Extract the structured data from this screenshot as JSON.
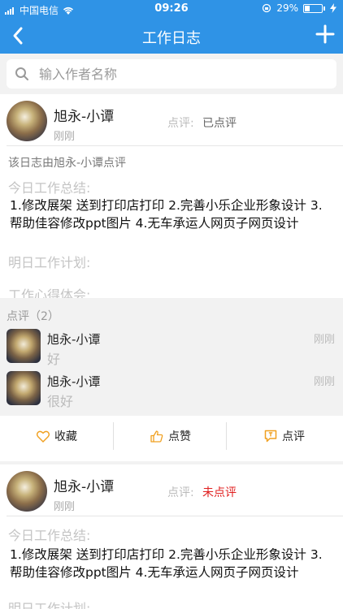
{
  "status_bar": {
    "carrier": "中国电信",
    "time": "09:26",
    "battery": "29%"
  },
  "nav": {
    "title": "工作日志"
  },
  "search": {
    "placeholder": "输入作者名称"
  },
  "colors": {
    "accent": "#2f93e6",
    "unreviewed": "#e02020",
    "comment_icon": "#f0a020"
  },
  "logs": [
    {
      "author": "旭永-小谭",
      "time": "刚刚",
      "review_label": "点评:",
      "review_status": "已点评",
      "reviewed_by_note": "该日志由旭永-小谭点评",
      "today_label": "今日工作总结:",
      "today_content": "1.修改展架 送到打印店打印 2.完善小乐企业形象设计 3.帮助佳容修改ppt图片 4.无车承运人网页子网页设计",
      "tomorrow_label": "明日工作计划:",
      "experience_label": "工作心得体会:",
      "comments_title": "点评（2）",
      "comments": [
        {
          "name": "旭永-小谭",
          "time": "刚刚",
          "text": "好"
        },
        {
          "name": "旭永-小谭",
          "time": "刚刚",
          "text": "很好"
        }
      ],
      "actions": {
        "favorite": "收藏",
        "like": "点赞",
        "comment": "点评"
      }
    },
    {
      "author": "旭永-小谭",
      "time": "刚刚",
      "review_label": "点评:",
      "review_status": "未点评",
      "today_label": "今日工作总结:",
      "today_content": "1.修改展架 送到打印店打印 2.完善小乐企业形象设计 3.帮助佳容修改ppt图片 4.无车承运人网页子网页设计",
      "tomorrow_label": "明日工作计划:"
    }
  ]
}
